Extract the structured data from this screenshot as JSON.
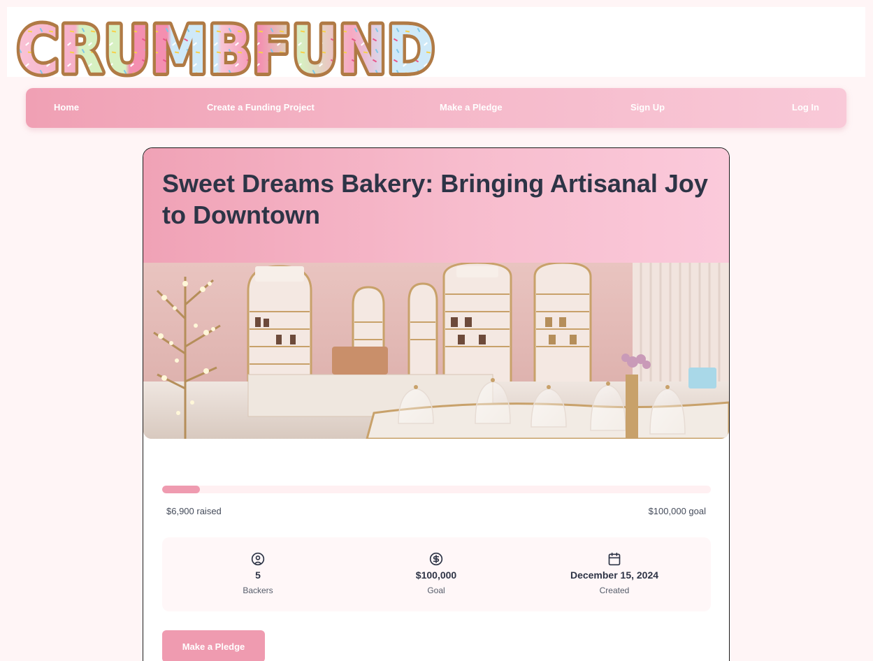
{
  "brand": {
    "logo_text": "CRUMBFUND"
  },
  "nav": {
    "items": [
      {
        "label": "Home"
      },
      {
        "label": "Create a Funding Project"
      },
      {
        "label": "Make a Pledge"
      },
      {
        "label": "Sign Up"
      },
      {
        "label": "Log In"
      }
    ]
  },
  "project": {
    "title": "Sweet Dreams Bakery: Bringing Artisanal Joy to Downtown",
    "raised_label": "$6,900 raised",
    "goal_label": "$100,000 goal",
    "progress_fraction": 0.069,
    "stats": [
      {
        "icon": "user-circle-icon",
        "value": "5",
        "label": "Backers"
      },
      {
        "icon": "dollar-circle-icon",
        "value": "$100,000",
        "label": "Goal"
      },
      {
        "icon": "calendar-icon",
        "value": "December 15, 2024",
        "label": "Created"
      }
    ],
    "pledge_button": "Make a Pledge"
  },
  "colors": {
    "accent": "#ef9bb0",
    "page_bg": "#fff5f6",
    "text_dark": "#2d3446"
  }
}
